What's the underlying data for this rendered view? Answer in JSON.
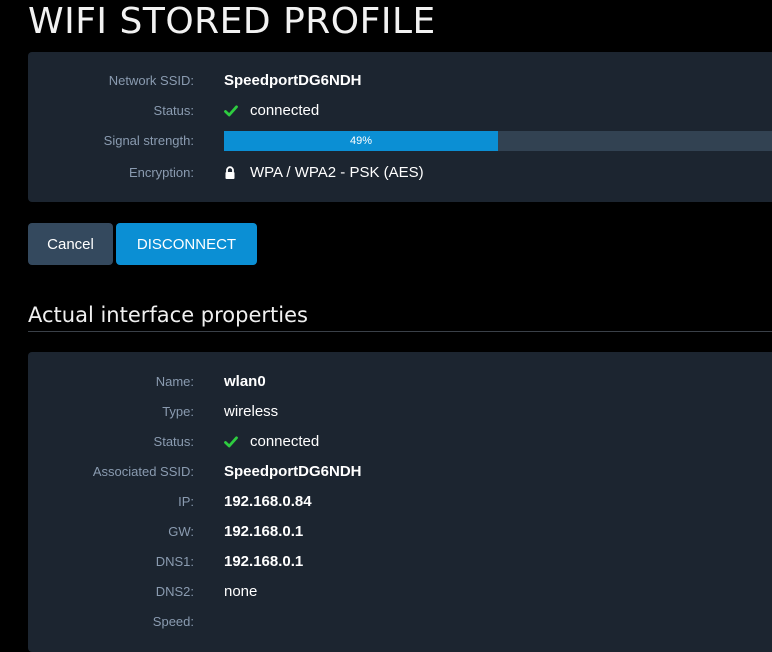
{
  "page": {
    "title": "WIFI STORED PROFILE"
  },
  "profile": {
    "rows": [
      {
        "label": "Network SSID:",
        "value": "SpeedportDG6NDH"
      },
      {
        "label": "Status:",
        "value": "connected",
        "icon": "check-icon"
      },
      {
        "label": "Signal strength:",
        "value": "49%",
        "progress": 0.49
      },
      {
        "label": "Encryption:",
        "value": "WPA / WPA2 - PSK (AES)",
        "icon": "lock-icon"
      }
    ]
  },
  "actions": {
    "cancel_label": "Cancel",
    "disconnect_label": "DISCONNECT"
  },
  "interface": {
    "title": "Actual interface properties",
    "rows": [
      {
        "label": "Name:",
        "value": "wlan0"
      },
      {
        "label": "Type:",
        "value": "wireless"
      },
      {
        "label": "Status:",
        "value": "connected",
        "icon": "check-icon"
      },
      {
        "label": "Associated SSID:",
        "value": "SpeedportDG6NDH"
      },
      {
        "label": "IP:",
        "value": "192.168.0.84"
      },
      {
        "label": "GW:",
        "value": "192.168.0.1"
      },
      {
        "label": "DNS1:",
        "value": "192.168.0.1"
      },
      {
        "label": "DNS2:",
        "value": "none"
      },
      {
        "label": "Speed:",
        "value": ""
      }
    ]
  },
  "colors": {
    "background": "#000000",
    "panel": "#1c2530",
    "label": "#8a9bb0",
    "accent": "#0b8fd4",
    "progress_track": "#324252",
    "success": "#2ecc40",
    "cancel_button": "#34495e"
  }
}
